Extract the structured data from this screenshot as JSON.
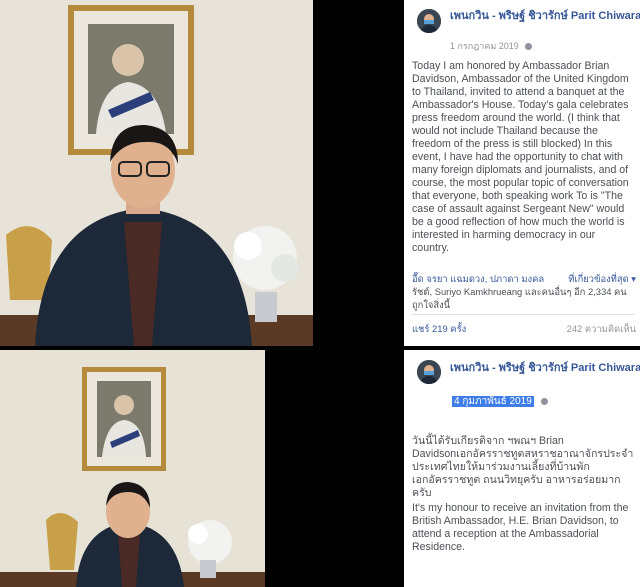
{
  "post1": {
    "author": "เพนกวิน - พริษฐ์ ชิวารักษ์ Parit Chiwarak",
    "date": "1 กรกฎาคม 2019",
    "body": "Today I am honored by Ambassador Brian Davidson, Ambassador of the United Kingdom to Thailand, invited to attend a banquet at the Ambassador's House. Today's gala celebrates press freedom around the world. (I think that would not include Thailand because the freedom of the press is still blocked) In this event, I have had the opportunity to chat with many foreign diplomats and journalists, and of course, the most popular topic of conversation that everyone, both speaking work To is \"The case of assault against Sergeant New\" would be a good reflection of how much the world is interested in harming democracy in our country.",
    "likers_line1": "อื๊ด จรยา แฉมดวง, ปภาดา มงคล",
    "most_relevant": "ที่เกี่ยวข้องที่สุด ▾",
    "likers_line2": "รัชต์, Suriyo Kamkhrueang และคนอื่นๆ อีก 2,334 คน",
    "likers_line3": "ถูกใจสิ่งนี้",
    "shares": "แชร์ 219 ครั้ง",
    "comments": "242 ความคิดเห็น"
  },
  "post2": {
    "author": "เพนกวิน - พริษฐ์ ชิวารักษ์ Parit Chiwarak",
    "date": "4 กุมภาพันธ์ 2019",
    "thai_body": "วันนี้ได้รับเกียรติจาก ฯพณฯ Brian Davidsonเอกอัครราชทูตสหราชอาณาจักรประจำประเทศไทยให้มาร่วมงานเลี้ยงที่บ้านพักเอกอัครราชทูต ถนนวิทยุครับ อาหารอร่อยมากครับ",
    "english_body": "It's my honour to receive an invitation from the British Ambassador, H.E. Brian Davidson, to attend a reception at the Ambassadorial Residence."
  },
  "colors": {
    "link_blue": "#385898",
    "date_highlight": "#3f7de8",
    "meta_gray": "#90949c"
  },
  "icons": [
    "avatar-photo",
    "globe-icon"
  ]
}
